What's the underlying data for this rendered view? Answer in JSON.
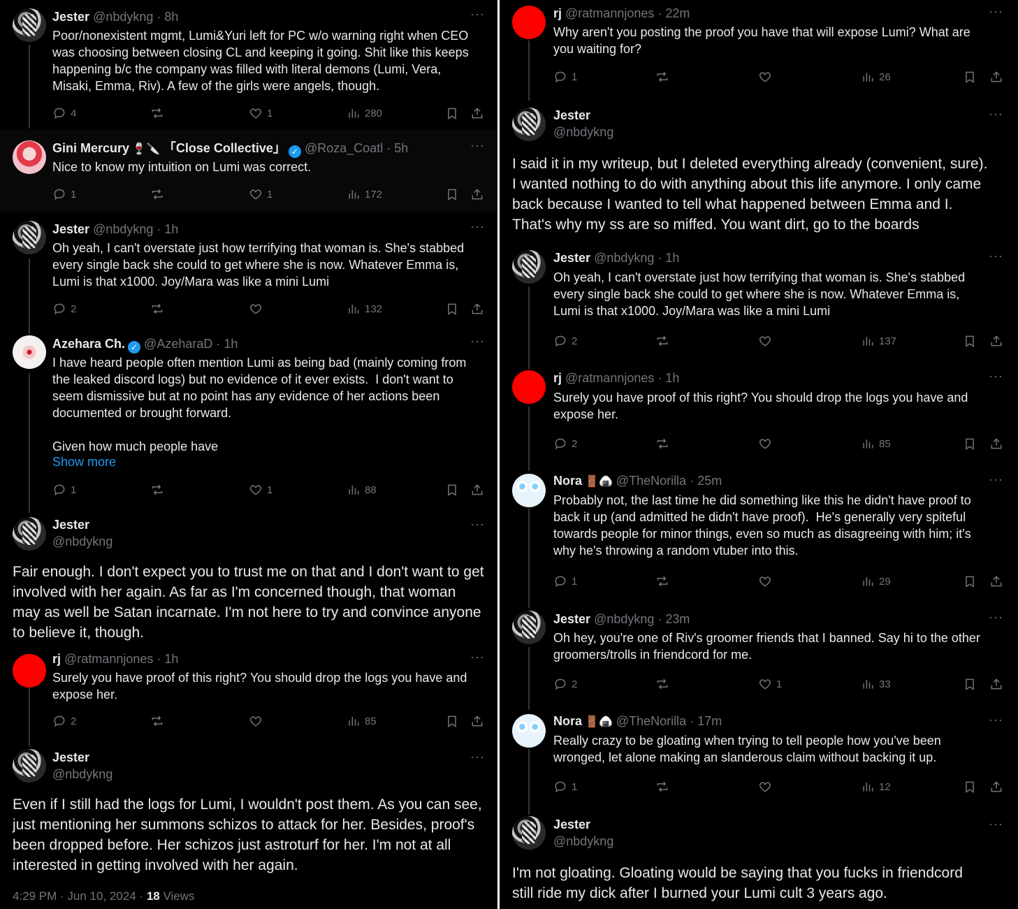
{
  "left": {
    "tweets": [
      {
        "name": "Jester",
        "handle": "@nbdykng",
        "time": "8h",
        "body": "Poor/nonexistent mgmt, Lumi&Yuri left for PC w/o warning right when CEO\nwas choosing between closing CL and keeping it going. Shit like this keeps\nhappening b/c the company was filled with literal demons (Lumi, Vera,\nMisaki, Emma, Riv). A few of the girls were angels, though.",
        "replies": "4",
        "reposts": "",
        "likes": "1",
        "views": "280"
      },
      {
        "name": "Gini Mercury",
        "emoji": "🍷🔪",
        "name_suffix": "「Close Collective」",
        "handle": "@Roza_Coatl",
        "time": "5h",
        "body": "Nice to know my intuition on Lumi was correct.",
        "replies": "1",
        "reposts": "",
        "likes": "1",
        "views": "172"
      },
      {
        "name": "Jester",
        "handle": "@nbdykng",
        "time": "1h",
        "body": "Oh yeah, I can't overstate just how terrifying that woman is. She's stabbed\nevery single back she could to get where she is now. Whatever Emma is,\nLumi is that x1000. Joy/Mara was like a mini Lumi",
        "replies": "2",
        "reposts": "",
        "likes": "",
        "views": "132"
      },
      {
        "name": "Azehara Ch.",
        "handle": "@AzeharaD",
        "time": "1h",
        "body": "I have heard people often mention Lumi as being bad (mainly coming from\nthe leaked discord logs) but no evidence of it ever exists.  I don't want to\nseem dismissive but at no point has any evidence of her actions been\ndocumented or brought forward.\n\nGiven how much people have",
        "show_more": "Show more",
        "replies": "1",
        "reposts": "",
        "likes": "1",
        "views": "88"
      },
      {
        "name": "Jester",
        "handle": "@nbdykng",
        "body": "Fair enough. I don't expect you to trust me on that and I don't want to get\ninvolved with her again. As far as I'm concerned though, that woman\nmay as well be Satan incarnate. I'm not here to try and convince anyone\nto believe it, though."
      },
      {
        "name": "rj",
        "handle": "@ratmannjones",
        "time": "1h",
        "body": "Surely you have proof of this right? You should drop the logs you have and\nexpose her.",
        "replies": "2",
        "reposts": "",
        "likes": "",
        "views": "85"
      },
      {
        "name": "Jester",
        "handle": "@nbdykng",
        "body": "Even if I still had the logs for Lumi, I wouldn't post them. As you can see,\njust mentioning her summons schizos to attack for her. Besides, proof's\nbeen dropped before. Her schizos just astroturf for her. I'm not at all\ninterested in getting involved with her again.",
        "timestamp": "4:29 PM · Jun 10, 2024",
        "view_count": "18",
        "view_label": "Views"
      }
    ]
  },
  "right": {
    "tweets": [
      {
        "name": "rj",
        "handle": "@ratmannjones",
        "time": "22m",
        "body": "Why aren't you posting the proof you have that will expose Lumi? What are\nyou waiting for?",
        "replies": "1",
        "reposts": "",
        "likes": "",
        "views": "26"
      },
      {
        "name": "Jester",
        "handle": "@nbdykng",
        "body": "I said it in my writeup, but I deleted everything already (convenient, sure).\nI wanted nothing to do with anything about this life anymore. I only came\nback because I wanted to tell what happened between Emma and I.\nThat's why my ss are so miffed. You want dirt, go to the boards"
      },
      {
        "name": "Jester",
        "handle": "@nbdykng",
        "time": "1h",
        "body": "Oh yeah, I can't overstate just how terrifying that woman is. She's stabbed\nevery single back she could to get where she is now. Whatever Emma is,\nLumi is that x1000. Joy/Mara was like a mini Lumi",
        "replies": "2",
        "reposts": "",
        "likes": "",
        "views": "137"
      },
      {
        "name": "rj",
        "handle": "@ratmannjones",
        "time": "1h",
        "body": "Surely you have proof of this right? You should drop the logs you have and\nexpose her.",
        "replies": "2",
        "reposts": "",
        "likes": "",
        "views": "85"
      },
      {
        "name": "Nora",
        "emoji": "🚪🍙",
        "handle": "@TheNorilla",
        "time": "25m",
        "body": "Probably not, the last time he did something like this he didn't have proof to\nback it up (and admitted he didn't have proof).  He's generally very spiteful\ntowards people for minor things, even so much as disagreeing with him; it's\nwhy he's throwing a random vtuber into this.",
        "replies": "1",
        "reposts": "",
        "likes": "",
        "views": "29"
      },
      {
        "name": "Jester",
        "handle": "@nbdykng",
        "time": "23m",
        "body": "Oh hey, you're one of Riv's groomer friends that I banned. Say hi to the other\ngroomers/trolls in friendcord for me.",
        "replies": "2",
        "reposts": "",
        "likes": "1",
        "views": "33"
      },
      {
        "name": "Nora",
        "emoji": "🚪🍙",
        "handle": "@TheNorilla",
        "time": "17m",
        "body": "Really crazy to be gloating when trying to tell people how you've been\nwronged, let alone making an slanderous claim without backing it up.",
        "replies": "1",
        "reposts": "",
        "likes": "",
        "views": "12"
      },
      {
        "name": "Jester",
        "handle": "@nbdykng",
        "body": "I'm not gloating. Gloating would be saying that you fucks in friendcord\nstill ride my dick after I burned your Lumi cult 3 years ago."
      }
    ]
  },
  "icons": {
    "more": "more-dots",
    "reply": "reply-icon",
    "repost": "repost-icon",
    "like": "like-icon",
    "views": "views-icon",
    "bookmark": "bookmark-icon",
    "share": "share-icon",
    "verified": "verified-badge"
  },
  "colors": {
    "background": "#000000",
    "text": "#e7e9ea",
    "muted": "#71767b",
    "link": "#1d9bf0"
  }
}
